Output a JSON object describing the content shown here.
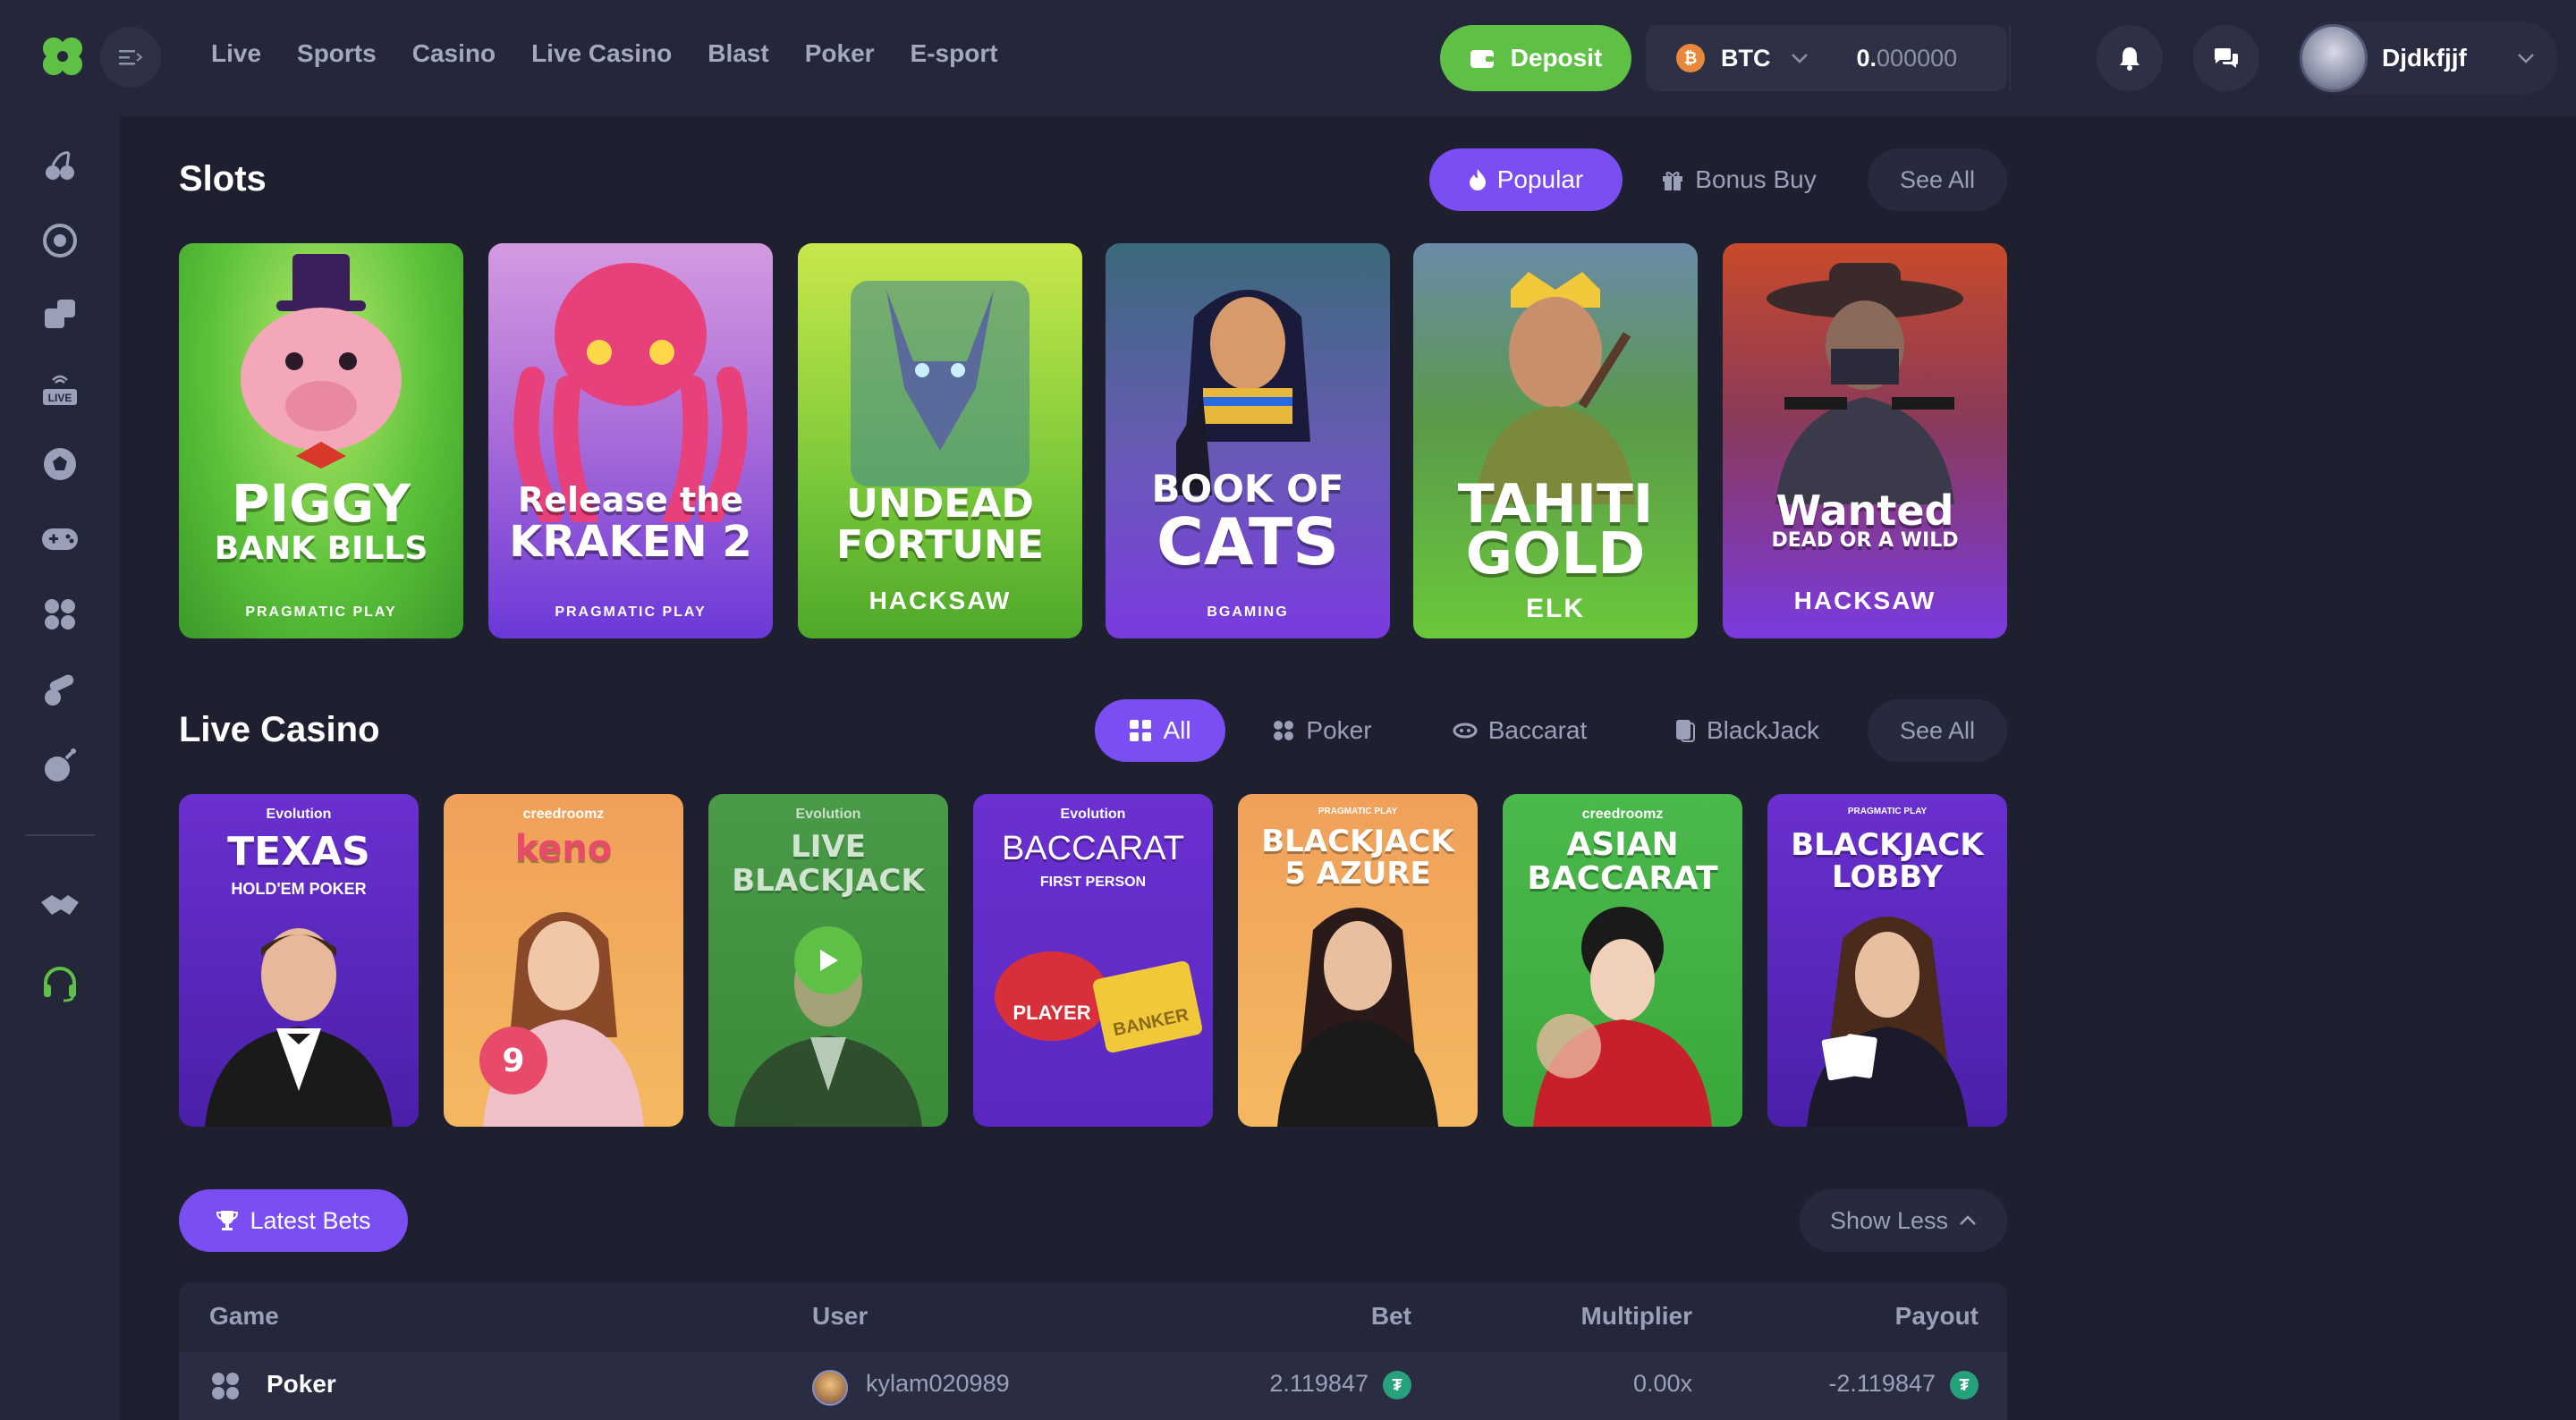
{
  "nav": {
    "items": [
      "Live",
      "Sports",
      "Casino",
      "Live Casino",
      "Blast",
      "Poker",
      "E-sport"
    ]
  },
  "header": {
    "deposit_label": "Deposit",
    "currency": "BTC",
    "currency_symbol": "₿",
    "balance_int": "0.",
    "balance_dec": "000000",
    "username": "Djdkfjjf"
  },
  "slots": {
    "title": "Slots",
    "tabs": [
      "Popular",
      "Bonus Buy"
    ],
    "see_all": "See All",
    "games": [
      {
        "line1": "PIGGY",
        "line2": "BANK BILLS",
        "provider": "PRAGMATIC PLAY"
      },
      {
        "line1": "Release the",
        "line2": "KRAKEN 2",
        "provider": "PRAGMATIC PLAY"
      },
      {
        "line1": "UNDEAD",
        "line2": "FORTUNE",
        "provider": "HACKSAW"
      },
      {
        "line1": "BOOK OF",
        "line2": "CATS",
        "provider": "BGAMING"
      },
      {
        "line1": "TAHITI",
        "line2": "GOLD",
        "provider": "ELK"
      },
      {
        "line1": "Wanted",
        "line2": "DEAD OR A WILD",
        "provider": "HACKSAW"
      }
    ]
  },
  "live_casino": {
    "title": "Live Casino",
    "tabs": [
      "All",
      "Poker",
      "Baccarat",
      "BlackJack"
    ],
    "see_all": "See All",
    "games": [
      {
        "provider": "Evolution",
        "line1": "TEXAS",
        "line2": "HOLD'EM POKER"
      },
      {
        "provider": "creedroomz",
        "line1": "keno",
        "line2": ""
      },
      {
        "provider": "Evolution",
        "line1": "LIVE",
        "line2": "BLACKJACK"
      },
      {
        "provider": "Evolution",
        "line1": "BACCARAT",
        "line2": "FIRST PERSON"
      },
      {
        "provider": "PRAGMATIC PLAY",
        "line1": "BLACKJACK",
        "line2": "5 AZURE"
      },
      {
        "provider": "creedroomz",
        "line1": "ASIAN",
        "line2": "BACCARAT"
      },
      {
        "provider": "PRAGMATIC PLAY",
        "line1": "BLACKJACK",
        "line2": "LOBBY"
      }
    ],
    "baccarat_player": "PLAYER",
    "baccarat_banker": "BANKER",
    "keno_ball": "9"
  },
  "bets": {
    "button": "Latest Bets",
    "toggle": "Show Less",
    "columns": [
      "Game",
      "User",
      "Bet",
      "Multiplier",
      "Payout"
    ],
    "rows": [
      {
        "game": "Poker",
        "user": "kylam020989",
        "bet": "2.119847",
        "multiplier": "0.00x",
        "payout": "-2.119847"
      }
    ]
  },
  "colors": {
    "accent": "#7a4ef2",
    "green": "#5ec146",
    "bg": "#1e2030",
    "panel": "#24273a"
  }
}
